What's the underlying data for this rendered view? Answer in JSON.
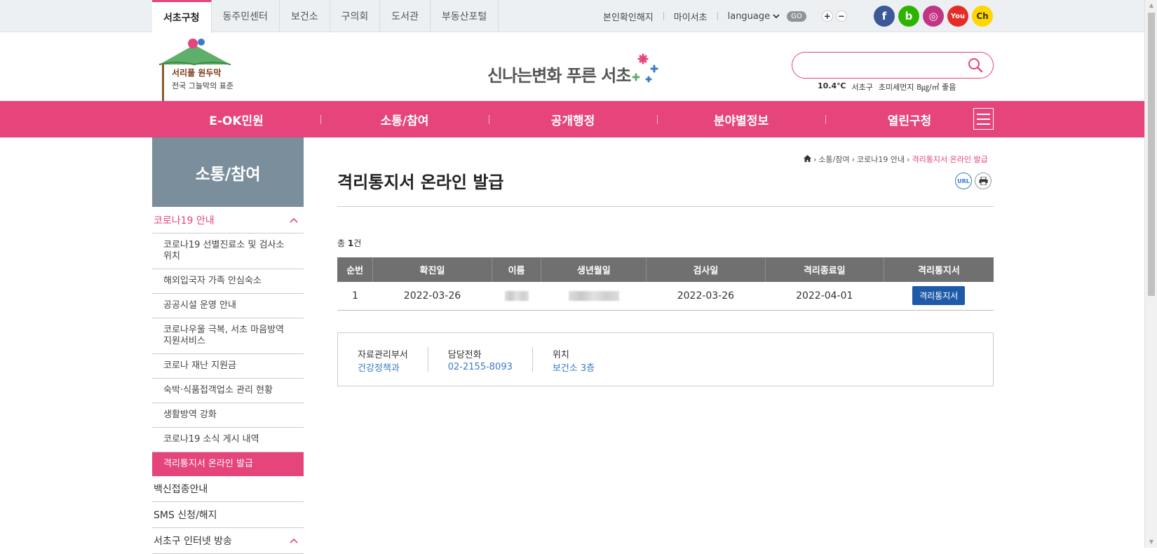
{
  "top_tabs": [
    "서초구청",
    "동주민센터",
    "보건소",
    "구의회",
    "도서관",
    "부동산포털"
  ],
  "top_links": {
    "unlink": "본인확인해지",
    "myseocho": "마이서초",
    "language": "language",
    "go": "GO",
    "zoom_in": "+",
    "zoom_out": "−"
  },
  "sns": [
    {
      "name": "facebook",
      "glyph": "f",
      "color": "#3b5998"
    },
    {
      "name": "blog",
      "glyph": "b",
      "color": "#2db400"
    },
    {
      "name": "instagram",
      "glyph": "◎",
      "color": "#c13584"
    },
    {
      "name": "youtube",
      "glyph": "You",
      "color": "#e52d27"
    },
    {
      "name": "kakao-channel",
      "glyph": "Ch",
      "color": "#ffd600"
    }
  ],
  "header": {
    "logo_line1": "서리풀 원두막",
    "logo_line2": "전국 그늘막의 표준",
    "slogan": "신나는변화 푸른 서초",
    "search_placeholder": "",
    "weather": {
      "temp": "10.4℃",
      "district": "서초구",
      "dust": "초미세먼지 8㎍/㎥ 좋음"
    }
  },
  "gnb": [
    "E-OK민원",
    "소통/참여",
    "공개행정",
    "분야별정보",
    "열린구청"
  ],
  "sidebar": {
    "title": "소통/참여",
    "category": "코로나19 안내",
    "items": [
      "코로나19 선별진료소 및 검사소 위치",
      "해외입국자 가족 안심숙소",
      "공공시설 운영 안내",
      "코로나우울 극복, 서초 마음방역 지원서비스",
      "코로나 재난 지원금",
      "숙박·식품접객업소 관리 현황",
      "생활방역 강화",
      "코로나19 소식 게시 내역",
      "격리통지서 온라인 발급"
    ],
    "active_index": 8,
    "others": [
      "백신접종안내",
      "SMS 신청/해지",
      "서초구 인터넷 방송"
    ]
  },
  "breadcrumb": [
    "소통/참여",
    "코로나19 안내",
    "격리통지서 온라인 발급"
  ],
  "page": {
    "title": "격리통지서 온라인 발급",
    "url_btn": "URL",
    "total_prefix": "총 ",
    "total_count": "1",
    "total_suffix": "건"
  },
  "table": {
    "headers": [
      "순번",
      "확진일",
      "이름",
      "생년월일",
      "검사일",
      "격리종료일",
      "격리통지서"
    ],
    "rows": [
      {
        "no": "1",
        "confirmed": "2022-03-26",
        "test_date": "2022-03-26",
        "end_date": "2022-04-01",
        "button": "격리통지서"
      }
    ]
  },
  "info": [
    {
      "label": "자료관리부서",
      "value": "건강정책과"
    },
    {
      "label": "담당전화",
      "value": "02-2155-8093"
    },
    {
      "label": "위치",
      "value": "보건소 3층"
    }
  ]
}
